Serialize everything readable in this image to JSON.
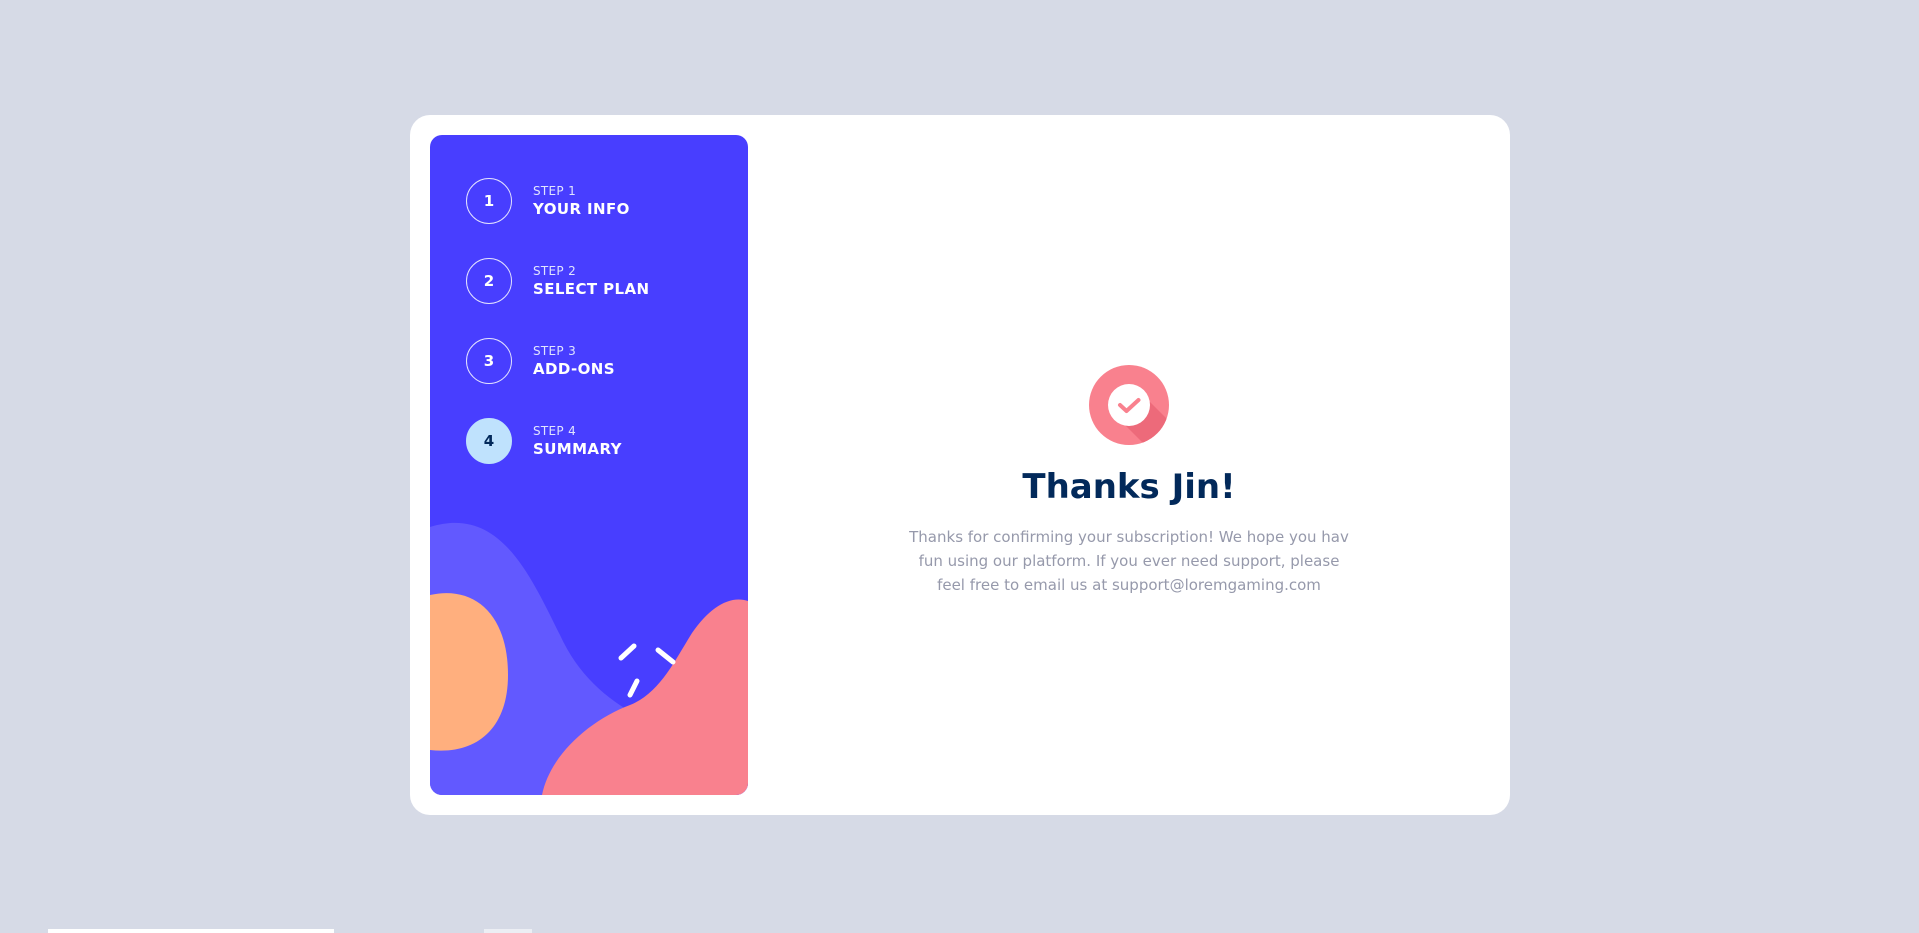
{
  "steps": [
    {
      "number": "1",
      "label": "STEP 1",
      "title": "YOUR INFO",
      "active": false
    },
    {
      "number": "2",
      "label": "STEP 2",
      "title": "SELECT PLAN",
      "active": false
    },
    {
      "number": "3",
      "label": "STEP 3",
      "title": "ADD-ONS",
      "active": false
    },
    {
      "number": "4",
      "label": "STEP 4",
      "title": "SUMMARY",
      "active": true
    }
  ],
  "thanks": {
    "icon": "check-icon",
    "title": "Thanks Jin!",
    "message": "Thanks for confirming your subscription! We hope you hav fun using our platform. If you ever need support, please feel free to email us at support@loremgaming.com"
  },
  "colors": {
    "page_bg": "#d6dae6",
    "sidebar_bg": "#483eff",
    "active_step": "#bfe2fd",
    "heading": "#02295a",
    "body_text": "#9699ab",
    "check_bg": "#f9818e",
    "decor_orange": "#ffaf7e",
    "decor_purple": "#6259ff"
  }
}
